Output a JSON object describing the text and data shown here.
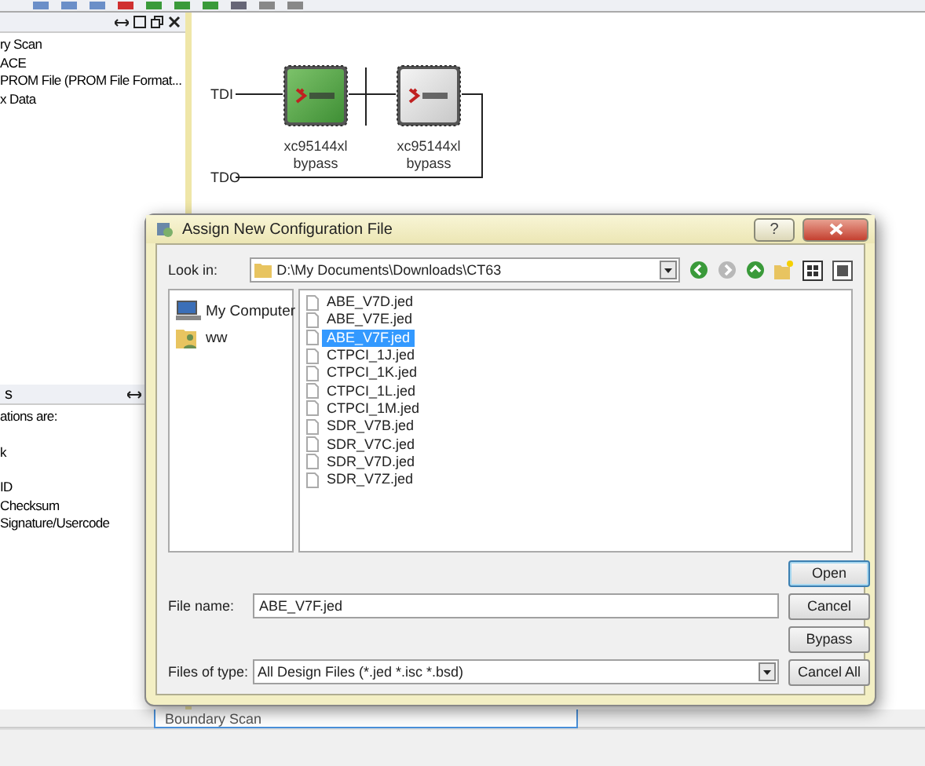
{
  "top_panel": {
    "items": [
      "ry Scan",
      "ACE",
      "PROM File (PROM File Format...",
      "x Data"
    ]
  },
  "bottom_panel": {
    "title": "s",
    "lines": [
      "ations are:",
      "k",
      "ID",
      "Checksum",
      "Signature/Usercode"
    ]
  },
  "canvas": {
    "tdi_label": "TDI",
    "tdo_label": "TDO",
    "devices": [
      {
        "part": "xc95144xl",
        "mode": "bypass",
        "selected": true
      },
      {
        "part": "xc95144xl",
        "mode": "bypass",
        "selected": false
      }
    ]
  },
  "tabs": [
    {
      "label": "Boundary Scan",
      "selected": true
    }
  ],
  "dialog": {
    "title": "Assign New Configuration File",
    "help_button": "?",
    "look_in_label": "Look in:",
    "look_in_path": "D:\\My Documents\\Downloads\\CT63",
    "places": [
      {
        "label": "My Computer",
        "kind": "computer"
      },
      {
        "label": "ww",
        "kind": "user"
      }
    ],
    "files": [
      {
        "name": "ABE_V7D.jed",
        "selected": false
      },
      {
        "name": "ABE_V7E.jed",
        "selected": false
      },
      {
        "name": "ABE_V7F.jed",
        "selected": true
      },
      {
        "name": "CTPCI_1J.jed",
        "selected": false
      },
      {
        "name": "CTPCI_1K.jed",
        "selected": false
      },
      {
        "name": "CTPCI_1L.jed",
        "selected": false
      },
      {
        "name": "CTPCI_1M.jed",
        "selected": false
      },
      {
        "name": "SDR_V7B.jed",
        "selected": false
      },
      {
        "name": "SDR_V7C.jed",
        "selected": false
      },
      {
        "name": "SDR_V7D.jed",
        "selected": false
      },
      {
        "name": "SDR_V7Z.jed",
        "selected": false
      }
    ],
    "file_name_label": "File name:",
    "file_name_value": "ABE_V7F.jed",
    "file_type_label": "Files of type:",
    "file_type_value": "All Design Files (*.jed *.isc *.bsd)",
    "buttons": [
      {
        "label": "Open",
        "default": true
      },
      {
        "label": "Cancel",
        "default": false
      },
      {
        "label": "Bypass",
        "default": false
      },
      {
        "label": "Cancel All",
        "default": false
      }
    ]
  }
}
